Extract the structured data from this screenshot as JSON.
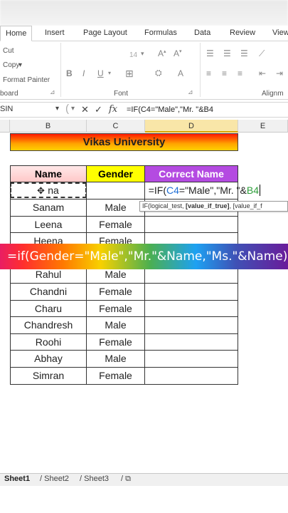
{
  "ribbon": {
    "tabs": [
      "Home",
      "Insert",
      "Page Layout",
      "Formulas",
      "Data",
      "Review",
      "View"
    ],
    "clipboard": {
      "cut": "Cut",
      "copy": "Copy",
      "format_painter": "Format Painter",
      "group": "board"
    },
    "font": {
      "size": "14",
      "group": "Font",
      "bold": "B",
      "italic": "I",
      "underline": "U"
    },
    "alignment_group": "Alignm"
  },
  "formula_bar": {
    "name_box": "SIN",
    "cancel": "✕",
    "enter": "✓",
    "fx": "fx",
    "formula": "=IF(C4=\"Male\",\"Mr. \"&B4"
  },
  "columns": [
    "B",
    "C",
    "D",
    "E"
  ],
  "sheet": {
    "title": "Vikas University",
    "headers": {
      "name": "Name",
      "gender": "Gender",
      "correct_name": "Correct Name"
    },
    "edit_cell": {
      "prefix": "=IF(",
      "ref1": "C4",
      "middle": "=\"Male\",\"Mr. \"&",
      "ref2": "B4"
    },
    "row1_name": "na",
    "rows": [
      {
        "name": "Sanam",
        "gender": "Male"
      },
      {
        "name": "Leena",
        "gender": "Female"
      },
      {
        "name": "Heena",
        "gender": "Female"
      },
      {
        "name": "",
        "gender": ""
      },
      {
        "name": "Rahul",
        "gender": "Male"
      },
      {
        "name": "Chandni",
        "gender": "Female"
      },
      {
        "name": "Charu",
        "gender": "Female"
      },
      {
        "name": "Chandresh",
        "gender": "Male"
      },
      {
        "name": "Roohi",
        "gender": "Female"
      },
      {
        "name": "Abhay",
        "gender": "Male"
      },
      {
        "name": "Simran",
        "gender": "Female"
      }
    ]
  },
  "tooltip": {
    "a": "IF(logical_test, ",
    "b": "[value_if_true]",
    "c": ", [value_if_f"
  },
  "banner": "=if(Gender=\"Male\",\"Mr.\"&Name,\"Ms.\"&Name)",
  "sheet_tabs": [
    "Sheet1",
    "Sheet2",
    "Sheet3"
  ],
  "colors": {
    "ref1": "#1f6fd6",
    "ref2": "#2e9e3a",
    "name_header": "#ffd9d9",
    "gender_header": "#ffff00",
    "correct_header": "#b44be1"
  }
}
